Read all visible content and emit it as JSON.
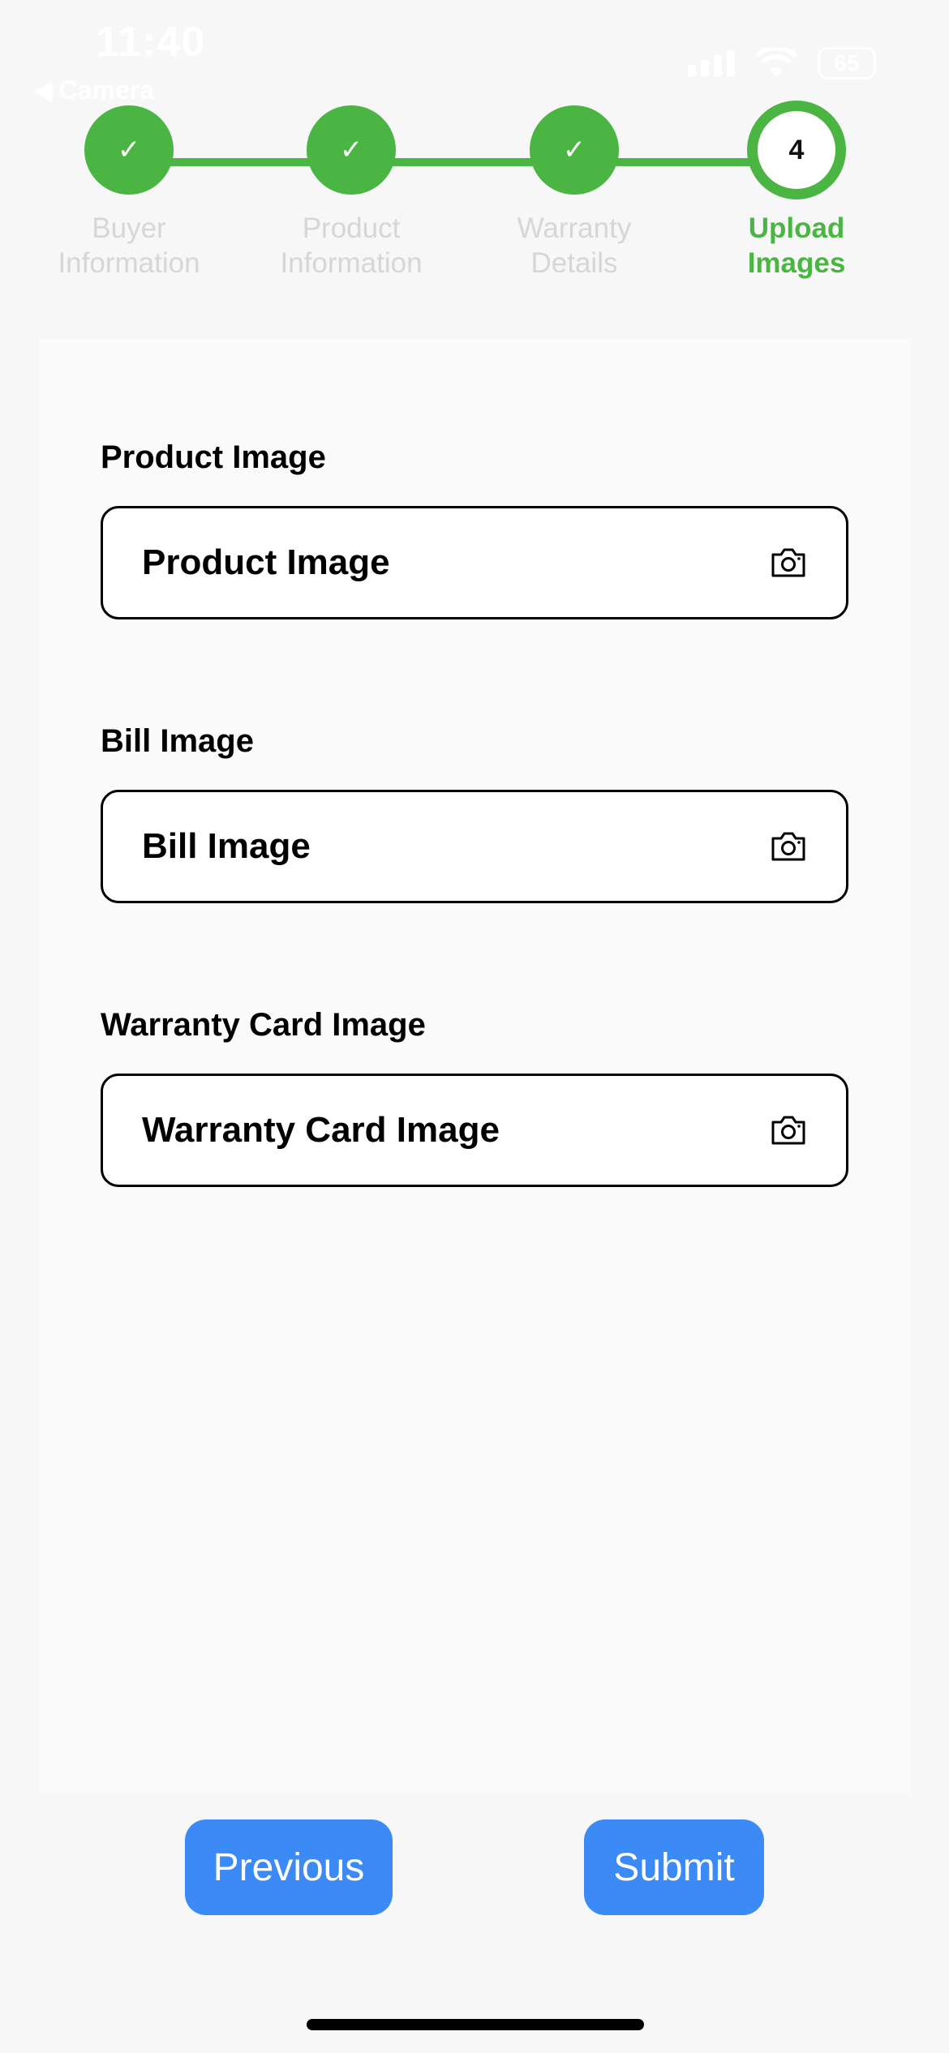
{
  "status_bar": {
    "time": "11:40",
    "back_label": "Camera",
    "battery": "65"
  },
  "stepper": {
    "steps": [
      {
        "label_line1": "Buyer",
        "label_line2": "Information",
        "state": "done",
        "marker": "✓"
      },
      {
        "label_line1": "Product",
        "label_line2": "Information",
        "state": "done",
        "marker": "✓"
      },
      {
        "label_line1": "Warranty",
        "label_line2": "Details",
        "state": "done",
        "marker": "✓"
      },
      {
        "label_line1": "Upload",
        "label_line2": "Images",
        "state": "active",
        "marker": "4"
      }
    ],
    "accent_color": "#4bb543"
  },
  "form": {
    "fields": [
      {
        "label": "Product Image",
        "placeholder": "Product Image",
        "icon": "camera-icon"
      },
      {
        "label": "Bill Image",
        "placeholder": "Bill Image",
        "icon": "camera-icon"
      },
      {
        "label": "Warranty Card Image",
        "placeholder": "Warranty Card Image",
        "icon": "camera-icon"
      }
    ]
  },
  "actions": {
    "previous_label": "Previous",
    "submit_label": "Submit",
    "button_color": "#3b8af5"
  }
}
